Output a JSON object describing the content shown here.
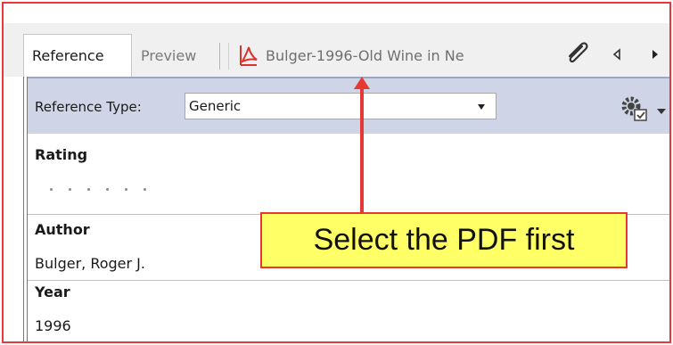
{
  "tabs": {
    "reference": "Reference",
    "preview": "Preview",
    "pdf": "Bulger-1996-Old Wine in Ne"
  },
  "reference_type": {
    "label": "Reference Type:",
    "value": "Generic"
  },
  "fields": {
    "rating_label": "Rating",
    "rating_stars": 0,
    "author_label": "Author",
    "author_value": "Bulger, Roger J.",
    "year_label": "Year",
    "year_value": "1996"
  },
  "annotation": {
    "text": "Select the PDF first"
  },
  "colors": {
    "annotation_border": "#e53935",
    "annotation_fill": "#ffff66",
    "header_strip": "#cfd5e6",
    "pdf_icon": "#d9342b"
  },
  "icons": [
    "pdf-icon",
    "paperclip-icon",
    "chevron-left-icon",
    "chevron-right-icon",
    "dropdown-arrow-icon",
    "gear-settings-icon"
  ]
}
